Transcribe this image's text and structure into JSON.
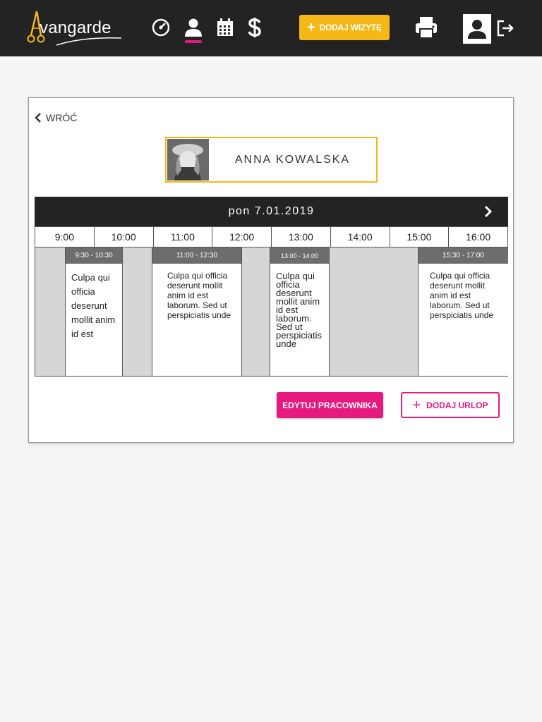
{
  "header": {
    "logo_text": "vangarde",
    "nav_icons": [
      "dashboard-icon",
      "employees-icon",
      "calendar-icon",
      "finance-icon"
    ],
    "add_visit_label": "DODAJ WIZYTĘ",
    "accent_yellow": "#f5b817",
    "accent_pink": "#e6197e"
  },
  "card": {
    "back_label": "WRÓĆ",
    "employee_name": "ANNA KOWALSKA"
  },
  "schedule": {
    "date": "pon 7.01.2019",
    "hours": [
      "9:00",
      "10:00",
      "11:00",
      "12:00",
      "13:00",
      "14:00",
      "15:00",
      "16:00"
    ],
    "appointments": [
      {
        "time": "9:30 - 10:30",
        "text": "Culpa qui officia deserunt mollit anim id est"
      },
      {
        "time": "11:00 - 12:30",
        "text": "Culpa qui officia deserunt mollit anim id est laborum. Sed ut perspiciatis unde"
      },
      {
        "time": "13:00 - 14:00",
        "text": "Culpa qui officia deserunt mollit anim id est laborum. Sed ut perspiciatis unde"
      },
      {
        "time": "15:30 - 17:00",
        "text": "Culpa qui officia deserunt mollit anim id est laborum. Sed ut perspiciatis unde"
      }
    ]
  },
  "actions": {
    "edit_label": "EDYTUJ PRACOWNIKA",
    "leave_label": "DODAJ URLOP"
  }
}
